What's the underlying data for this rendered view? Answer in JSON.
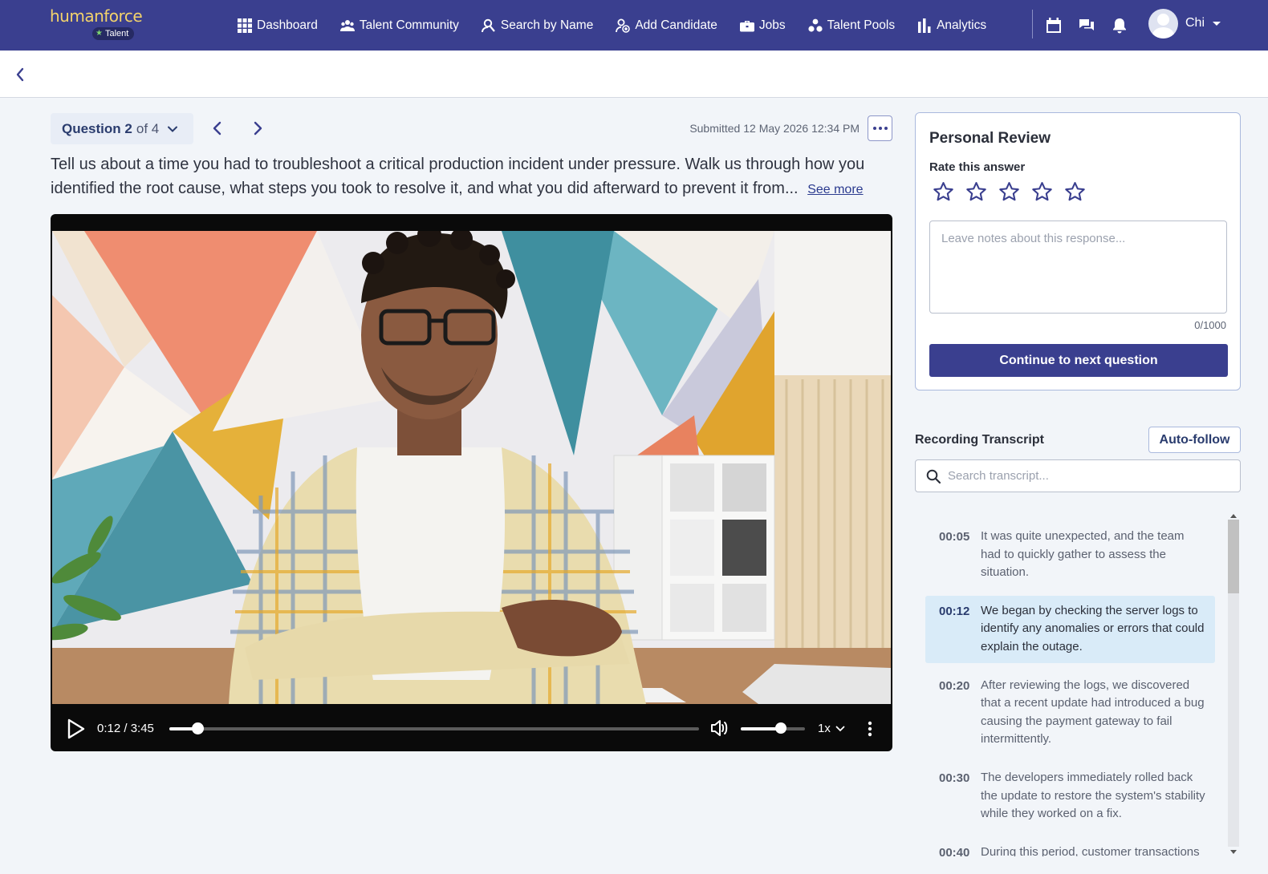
{
  "app": {
    "brand": "humanforce",
    "brand_badge": "Talent"
  },
  "nav": {
    "items": [
      {
        "label": "Dashboard",
        "icon": "grid-icon"
      },
      {
        "label": "Talent Community",
        "icon": "people-icon"
      },
      {
        "label": "Search by Name",
        "icon": "person-search-icon"
      },
      {
        "label": "Add Candidate",
        "icon": "person-add-icon"
      },
      {
        "label": "Jobs",
        "icon": "briefcase-icon"
      },
      {
        "label": "Talent Pools",
        "icon": "pools-icon"
      },
      {
        "label": "Analytics",
        "icon": "bar-chart-icon"
      }
    ],
    "icons": [
      "calendar-icon",
      "chat-icon",
      "bell-icon"
    ],
    "user_name": "Chi"
  },
  "question": {
    "label": "Question",
    "number": "2",
    "of_text": "of 4",
    "submitted": "Submitted 12 May 2026 12:34 PM",
    "text": "Tell us about a time you had to troubleshoot a critical production incident under pressure. Walk us through how you identified the root cause, what steps you took to resolve it, and what you did afterward to prevent it from...",
    "see_more": "See more"
  },
  "video": {
    "time_display": "0:12 / 3:45",
    "progress_fraction": 0.053,
    "volume_fraction": 0.63,
    "speed": "1x"
  },
  "review": {
    "title": "Personal Review",
    "rate_label": "Rate this answer",
    "star_count": 5,
    "rating": 0,
    "notes_placeholder": "Leave notes about this response...",
    "notes_value": "",
    "counter": "0/1000",
    "continue_label": "Continue to next question"
  },
  "transcript": {
    "title": "Recording Transcript",
    "autofollow_label": "Auto-follow",
    "search_placeholder": "Search transcript...",
    "active_index": 1,
    "entries": [
      {
        "time": "00:05",
        "text": "It was quite unexpected, and the team had to quickly gather to assess the situation."
      },
      {
        "time": "00:12",
        "text": "We began by checking the server logs to identify any anomalies or errors that could explain the outage."
      },
      {
        "time": "00:20",
        "text": "After reviewing the logs, we discovered that a recent update had introduced a bug causing the payment gateway to fail intermittently."
      },
      {
        "time": "00:30",
        "text": "The developers immediately rolled back the update to restore the system's stability while they worked on a fix."
      },
      {
        "time": "00:40",
        "text": "During this period, customer transactions were delayed, and we needed to communicate the situation to them."
      }
    ]
  },
  "colors": {
    "brand_primary": "#3a3f8f",
    "brand_logo": "#f3d36b",
    "active_highlight": "#d9ebf8"
  }
}
